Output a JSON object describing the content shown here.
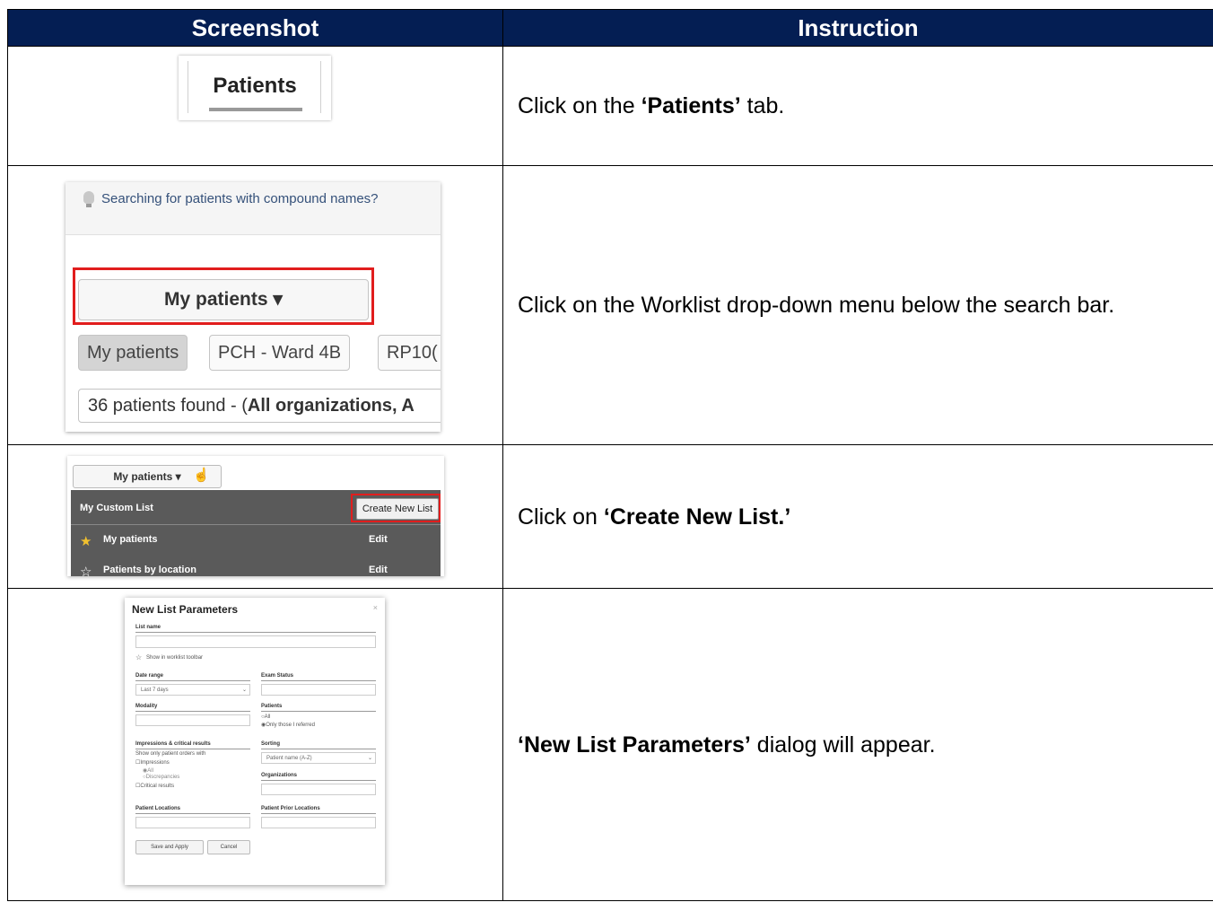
{
  "header": {
    "col_screenshot": "Screenshot",
    "col_instruction": "Instruction"
  },
  "rows": [
    {
      "instruction_pre": "Click on the ",
      "instruction_bold": "‘Patients’",
      "instruction_post": " tab.",
      "shot": {
        "tab_label": "Patients"
      }
    },
    {
      "instruction_pre": "Click on the Worklist drop-down menu below the search bar.",
      "instruction_bold": "",
      "instruction_post": "",
      "shot": {
        "hint": "Searching for patients with compound names?",
        "dropdown_label": "My patients",
        "dropdown_caret": "▾",
        "pills": [
          "My patients",
          "PCH - Ward 4B",
          "RP10("
        ],
        "found_pre": "36 patients found - (",
        "found_bold": "All organizations",
        "found_post": ", A"
      }
    },
    {
      "instruction_pre": "Click on ",
      "instruction_bold": "‘Create New List.’",
      "instruction_post": "",
      "shot": {
        "dropdown_label": "My patients ▾",
        "panel_title": "My Custom List",
        "create_button": "Create New List",
        "items": [
          {
            "label": "My patients",
            "action": "Edit",
            "starred": true
          },
          {
            "label": "Patients by location",
            "action": "Edit",
            "starred": false
          }
        ]
      }
    },
    {
      "instruction_pre": "",
      "instruction_bold": "‘New List Parameters’",
      "instruction_post": " dialog will appear.",
      "shot": {
        "title": "New List Parameters",
        "close": "×",
        "list_name": "List name",
        "show_toolbar": "Show in worklist toolbar",
        "date_range": "Date range",
        "date_range_value": "Last 7 days",
        "exam_status": "Exam Status",
        "modality": "Modality",
        "patients": "Patients",
        "patients_all": "All",
        "patients_referred": "Only those I referred",
        "impressions_title": "Impressions & critical results",
        "impressions_sub": "Show only patient orders with",
        "impressions": "Impressions",
        "all": "All",
        "discrepancies": "Discrepancies",
        "critical": "Critical results",
        "sorting": "Sorting",
        "sorting_value": "Patient name (A-Z)",
        "organizations": "Organizations",
        "patient_locations": "Patient Locations",
        "patient_prior_locations": "Patient Prior Locations",
        "save_apply": "Save and Apply",
        "cancel": "Cancel"
      }
    }
  ],
  "colors": {
    "header_bg": "#041e53",
    "highlight_red": "#e11d1d",
    "menu_bg": "#5a5a5a",
    "star_yellow": "#f2c12e"
  }
}
